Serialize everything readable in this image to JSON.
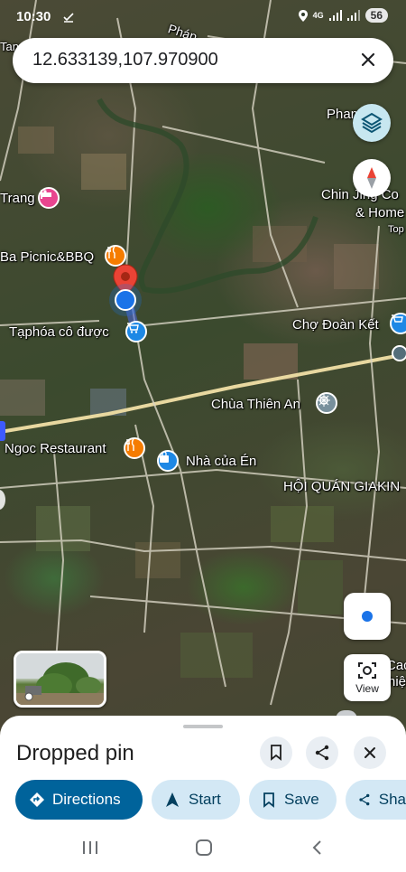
{
  "status_bar": {
    "time": "10:30",
    "network": "4G",
    "battery": "56"
  },
  "search": {
    "value": "12.633139,107.970900"
  },
  "map_labels": {
    "phap": "Pháp",
    "pham": "Pham",
    "chin_jing": "Chin Jing Co",
    "home": "& Home",
    "top": "Top",
    "trang": "Trang",
    "picnic": "Ba Picnic&BBQ",
    "taphoa": "Tạphóa cô được",
    "cho_doan_ket": "Chợ Đoàn Kết",
    "chua_thien_an": "Chùa Thiên An",
    "ngoc_restaurant": "Ngoc Restaurant",
    "nha_cua_en": "Nhà của Én",
    "hoi_quan": "HỘI QUÁN GIAKIN",
    "cac": "Cac",
    "hie": "hiệ",
    "tang_left": "Tang"
  },
  "view_button": {
    "label": "View"
  },
  "sheet": {
    "title": "Dropped pin",
    "actions": {
      "directions": "Directions",
      "start": "Start",
      "save": "Save",
      "share": "Sha"
    }
  },
  "icons": {
    "layers": "layers-icon",
    "compass": "compass-icon",
    "my_location": "my-location-icon",
    "bookmark": "bookmark-icon",
    "share": "share-icon",
    "close": "close-icon"
  },
  "colors": {
    "pin_red": "#ea4335",
    "location_blue": "#1a73e8",
    "primary_chip": "#00639b",
    "secondary_chip": "#d3e8f5",
    "poi_orange": "#f57c00",
    "poi_blue": "#1e88e5",
    "poi_pink": "#e8458f"
  }
}
